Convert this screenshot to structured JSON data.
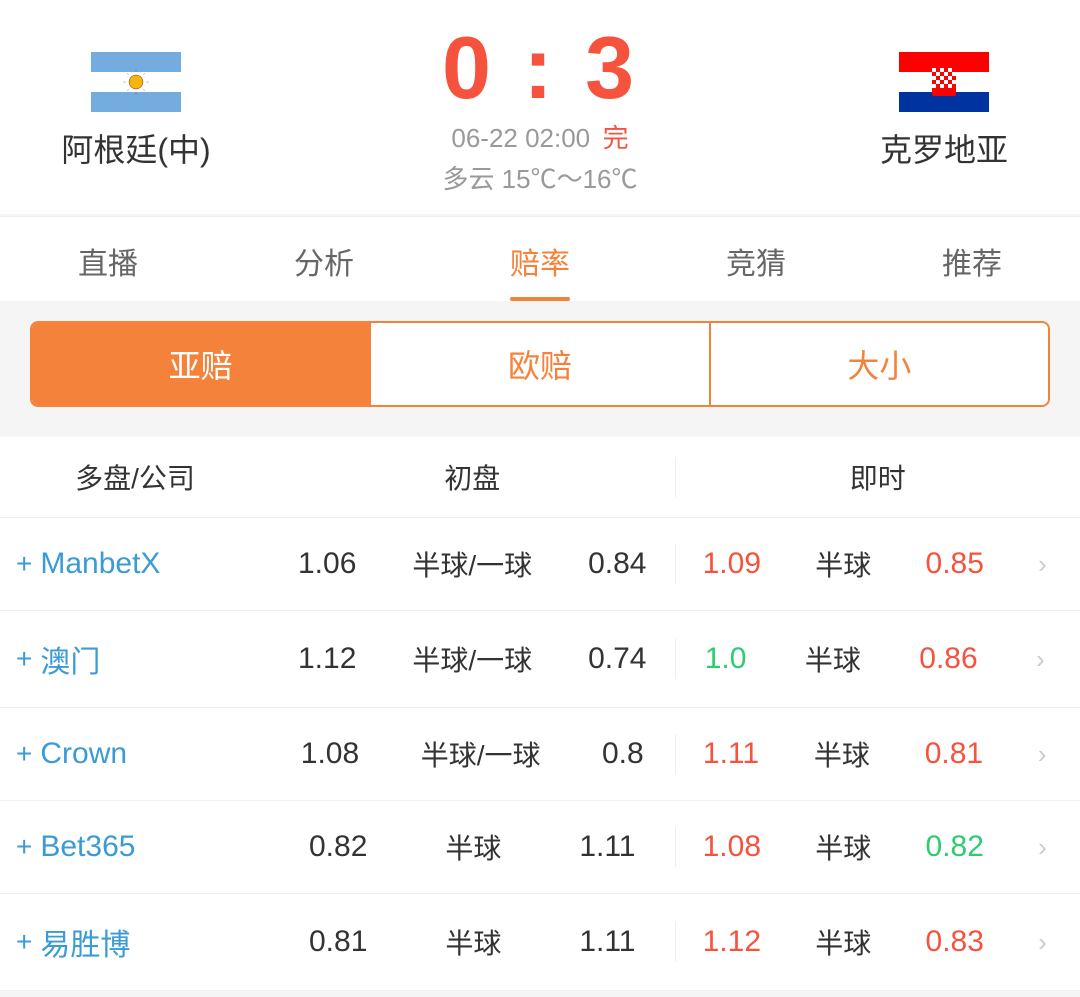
{
  "header": {
    "team_left": "阿根廷(中)",
    "team_right": "克罗地亚",
    "score_left": "0",
    "score_colon": ":",
    "score_right": "3",
    "datetime": "06-22 02:00",
    "status": "完",
    "weather": "多云  15℃～16℃"
  },
  "tabs": [
    {
      "label": "直播",
      "active": false
    },
    {
      "label": "分析",
      "active": false
    },
    {
      "label": "赔率",
      "active": true
    },
    {
      "label": "竞猜",
      "active": false
    },
    {
      "label": "推荐",
      "active": false
    }
  ],
  "subtabs": [
    {
      "label": "亚赔",
      "active": true
    },
    {
      "label": "欧赔",
      "active": false
    },
    {
      "label": "大小",
      "active": false
    }
  ],
  "table": {
    "header": {
      "col1": "多盘/公司",
      "col2": "初盘",
      "col3": "即时"
    },
    "rows": [
      {
        "company": "ManbetX",
        "init_v1": "1.06",
        "init_label": "半球/一球",
        "init_v2": "0.84",
        "rt_v1": "1.09",
        "rt_v1_color": "orange",
        "rt_label": "半球",
        "rt_v2": "0.85",
        "rt_v2_color": "orange"
      },
      {
        "company": "澳门",
        "init_v1": "1.12",
        "init_label": "半球/一球",
        "init_v2": "0.74",
        "rt_v1": "1.0",
        "rt_v1_color": "green",
        "rt_label": "半球",
        "rt_v2": "0.86",
        "rt_v2_color": "orange"
      },
      {
        "company": "Crown",
        "init_v1": "1.08",
        "init_label": "半球/一球",
        "init_v2": "0.8",
        "rt_v1": "1.11",
        "rt_v1_color": "orange",
        "rt_label": "半球",
        "rt_v2": "0.81",
        "rt_v2_color": "orange"
      },
      {
        "company": "Bet365",
        "init_v1": "0.82",
        "init_label": "半球",
        "init_v2": "1.11",
        "rt_v1": "1.08",
        "rt_v1_color": "orange",
        "rt_label": "半球",
        "rt_v2": "0.82",
        "rt_v2_color": "green"
      },
      {
        "company": "易胜博",
        "init_v1": "0.81",
        "init_label": "半球",
        "init_v2": "1.11",
        "rt_v1": "1.12",
        "rt_v1_color": "orange",
        "rt_label": "半球",
        "rt_v2": "0.83",
        "rt_v2_color": "orange"
      }
    ]
  }
}
